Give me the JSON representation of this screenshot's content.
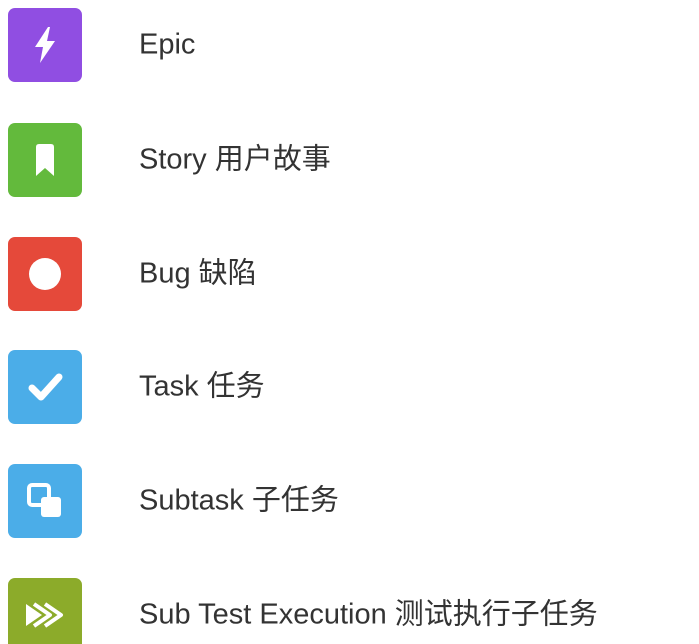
{
  "issue_types": [
    {
      "name": "Epic",
      "icon": "lightning-icon",
      "color": "#904ee2"
    },
    {
      "name": "Story 用户故事",
      "icon": "bookmark-icon",
      "color": "#63ba3c"
    },
    {
      "name": "Bug 缺陷",
      "icon": "circle-icon",
      "color": "#e5493a"
    },
    {
      "name": "Task 任务",
      "icon": "checkmark-icon",
      "color": "#4bade8"
    },
    {
      "name": "Subtask 子任务",
      "icon": "subtask-icon",
      "color": "#4bade8"
    },
    {
      "name": "Sub Test Execution 测试执行子任务",
      "icon": "double-arrow-icon",
      "color": "#8cab2a"
    }
  ]
}
